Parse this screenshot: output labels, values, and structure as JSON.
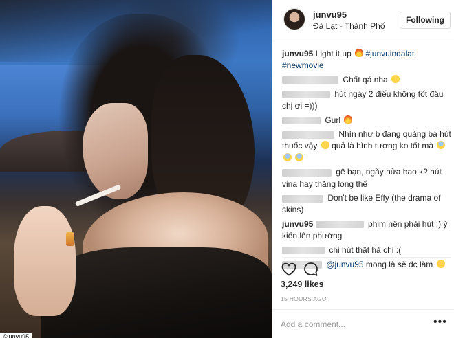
{
  "photo": {
    "watermark": "©junvu95"
  },
  "header": {
    "username": "junvu95",
    "location": "Đà Lạt - Thành Phố",
    "follow_label": "Following"
  },
  "caption": {
    "username": "junvu95",
    "text": "Light it up",
    "hashtag1": "#junvuindalat",
    "hashtag2": "#newmovie"
  },
  "comments": [
    {
      "text": "Chất qá nha",
      "emoji": "laughing-emoji"
    },
    {
      "text": "hút ngày 2 điếu không tốt đâu chị ơi =)))"
    },
    {
      "text": "Gurl",
      "emoji": "fire-emoji"
    },
    {
      "text": "Nhìn như b đang quảng bá hút thuốc vậy",
      "text2": "quả là hình tượng ko tốt mà",
      "emoji": "scream-emoji"
    },
    {
      "text": "gê bạn, ngày nửa bao k? hút vina hay thăng long thế"
    },
    {
      "text": "Don't be like Effy (the drama of skins)"
    },
    {
      "username": "junvu95",
      "text": "phim nên phải hút :) ý kiến lên phường"
    },
    {
      "text": "chị hút thật hả chị :("
    },
    {
      "mention": "@junvu95",
      "text": "mong là sẽ đc làm",
      "emoji": "sweat-emoji"
    }
  ],
  "actions": {
    "like_icon": "heart-icon",
    "comment_icon": "comment-bubble-icon"
  },
  "likes": "3,249 likes",
  "timestamp": "15 HOURS AGO",
  "add_comment": {
    "placeholder": "Add a comment...",
    "more_icon": "more-options-icon",
    "more_glyph": "•••"
  }
}
